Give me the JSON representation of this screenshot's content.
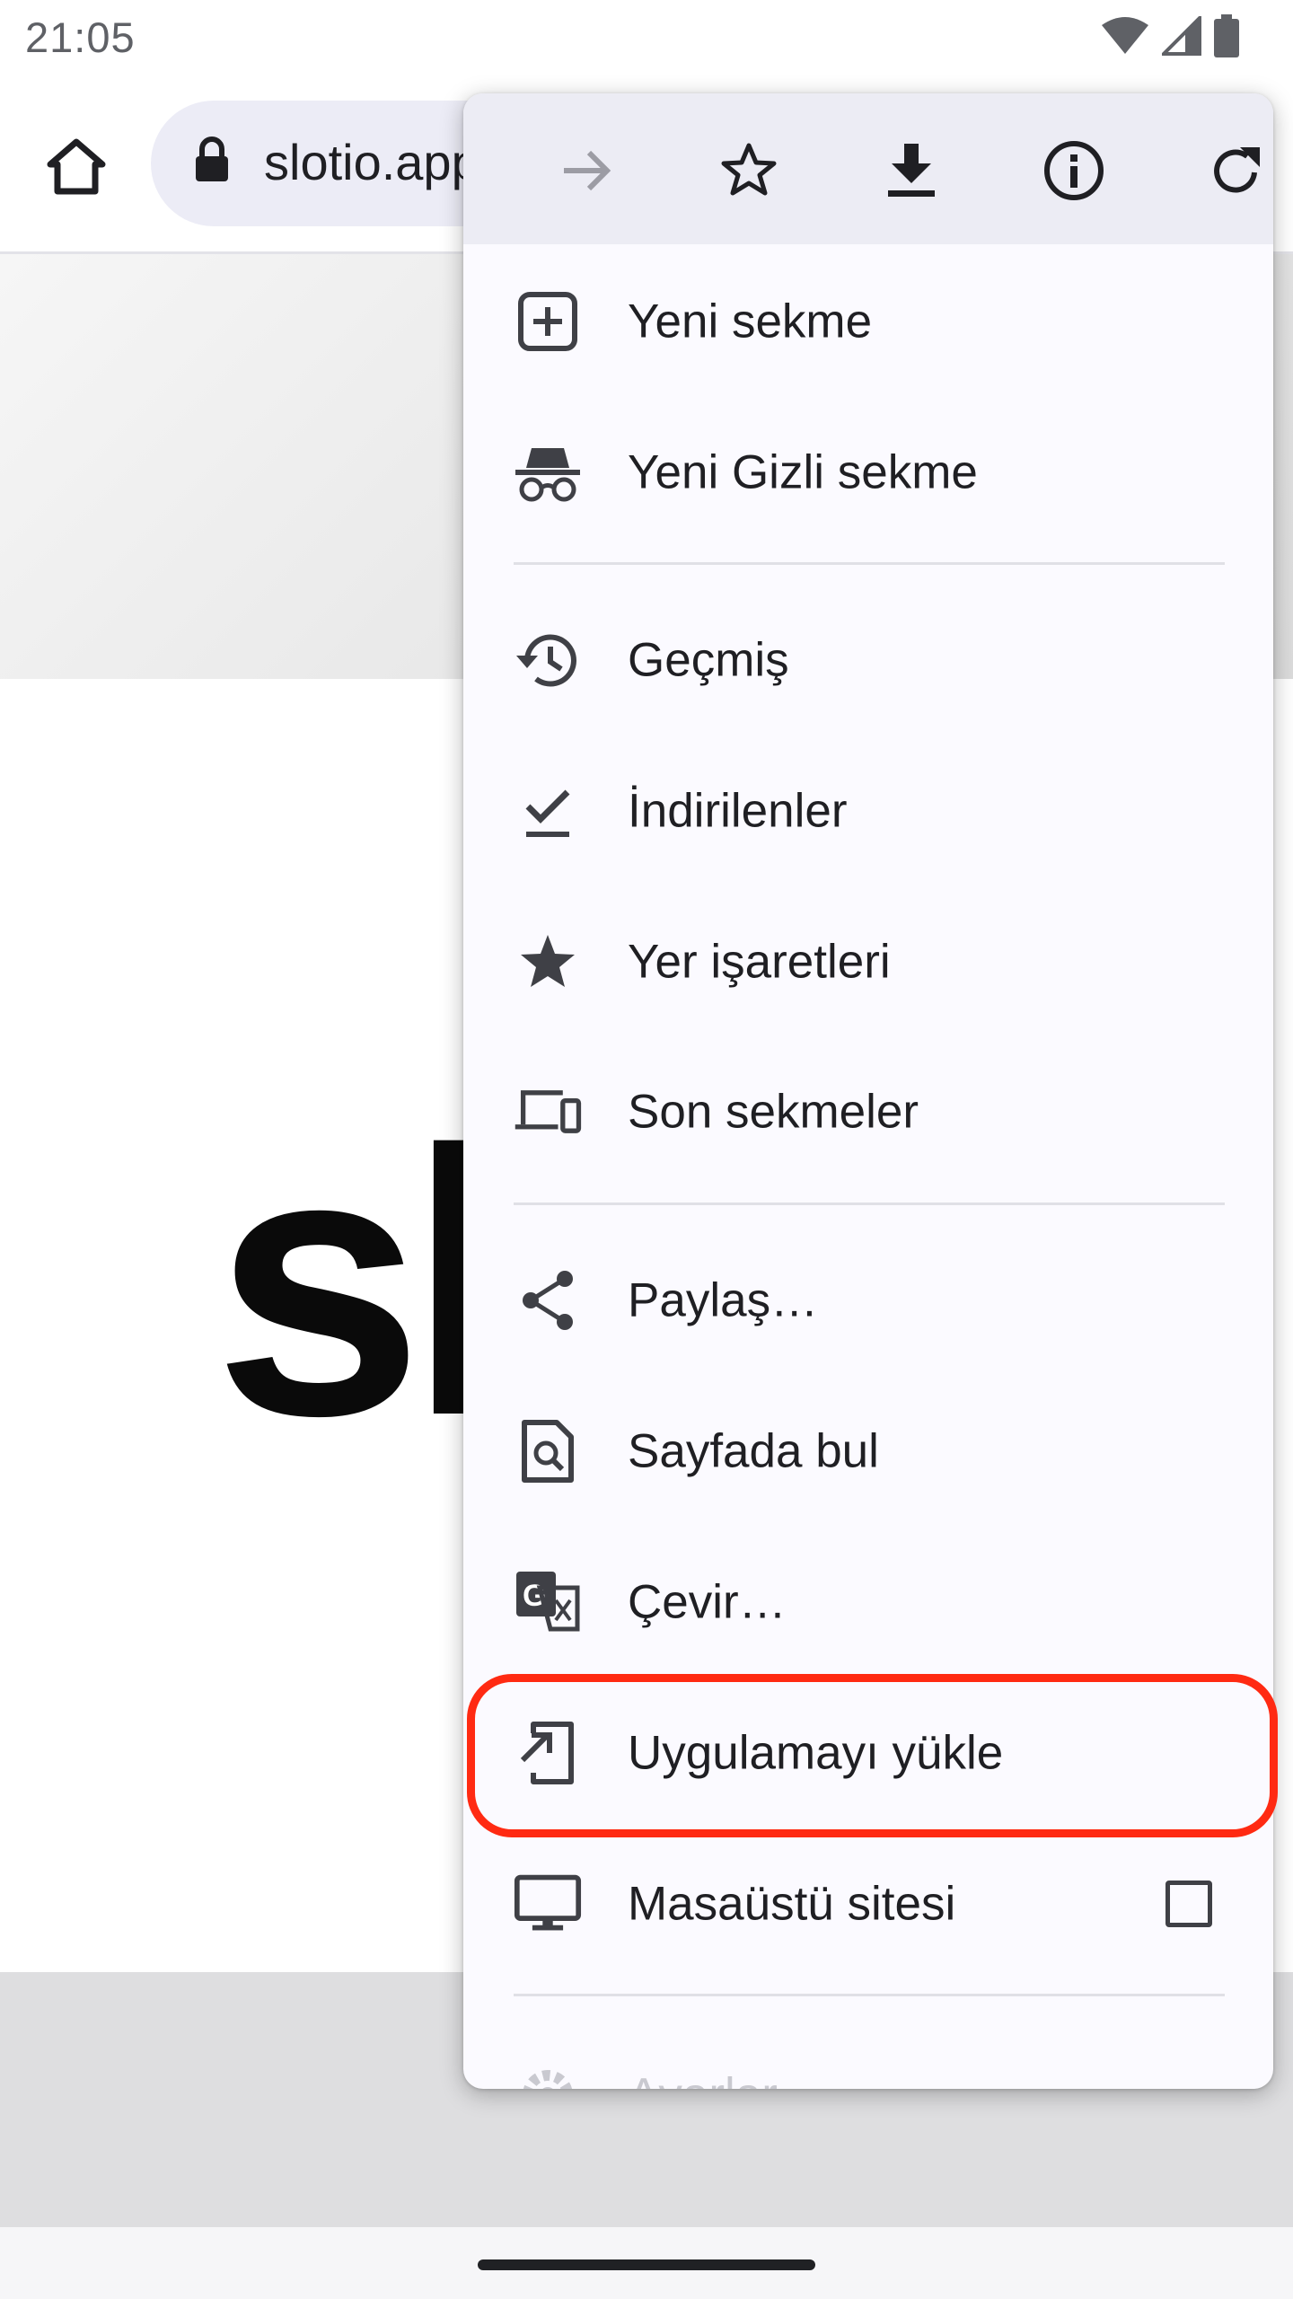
{
  "status_bar": {
    "time": "21:05"
  },
  "toolbar": {
    "url": "slotio.app"
  },
  "page": {
    "logo_text": "sl"
  },
  "menu": {
    "actions": [
      {
        "icon": "forward-icon",
        "enabled": false
      },
      {
        "icon": "star-outline-icon",
        "enabled": true
      },
      {
        "icon": "download-icon",
        "enabled": true
      },
      {
        "icon": "info-icon",
        "enabled": true
      },
      {
        "icon": "refresh-icon",
        "enabled": true
      }
    ],
    "items": [
      {
        "label": "Yeni sekme",
        "icon": "new-tab-icon"
      },
      {
        "label": "Yeni Gizli sekme",
        "icon": "incognito-icon"
      },
      {
        "label": "Geçmiş",
        "icon": "history-icon"
      },
      {
        "label": "İndirilenler",
        "icon": "downloads-check-icon"
      },
      {
        "label": "Yer işaretleri",
        "icon": "bookmark-star-icon"
      },
      {
        "label": "Son sekmeler",
        "icon": "devices-icon"
      },
      {
        "label": "Paylaş…",
        "icon": "share-icon"
      },
      {
        "label": "Sayfada bul",
        "icon": "find-in-page-icon"
      },
      {
        "label": "Çevir…",
        "icon": "translate-icon"
      },
      {
        "label": "Uygulamayı yükle",
        "icon": "install-app-icon"
      },
      {
        "label": "Masaüstü sitesi",
        "icon": "desktop-icon",
        "checkbox": false
      },
      {
        "label": "Ayarlar",
        "icon": "settings-icon"
      }
    ]
  },
  "colors": {
    "highlight": "#ff2a12",
    "icon": "#3f4046"
  }
}
